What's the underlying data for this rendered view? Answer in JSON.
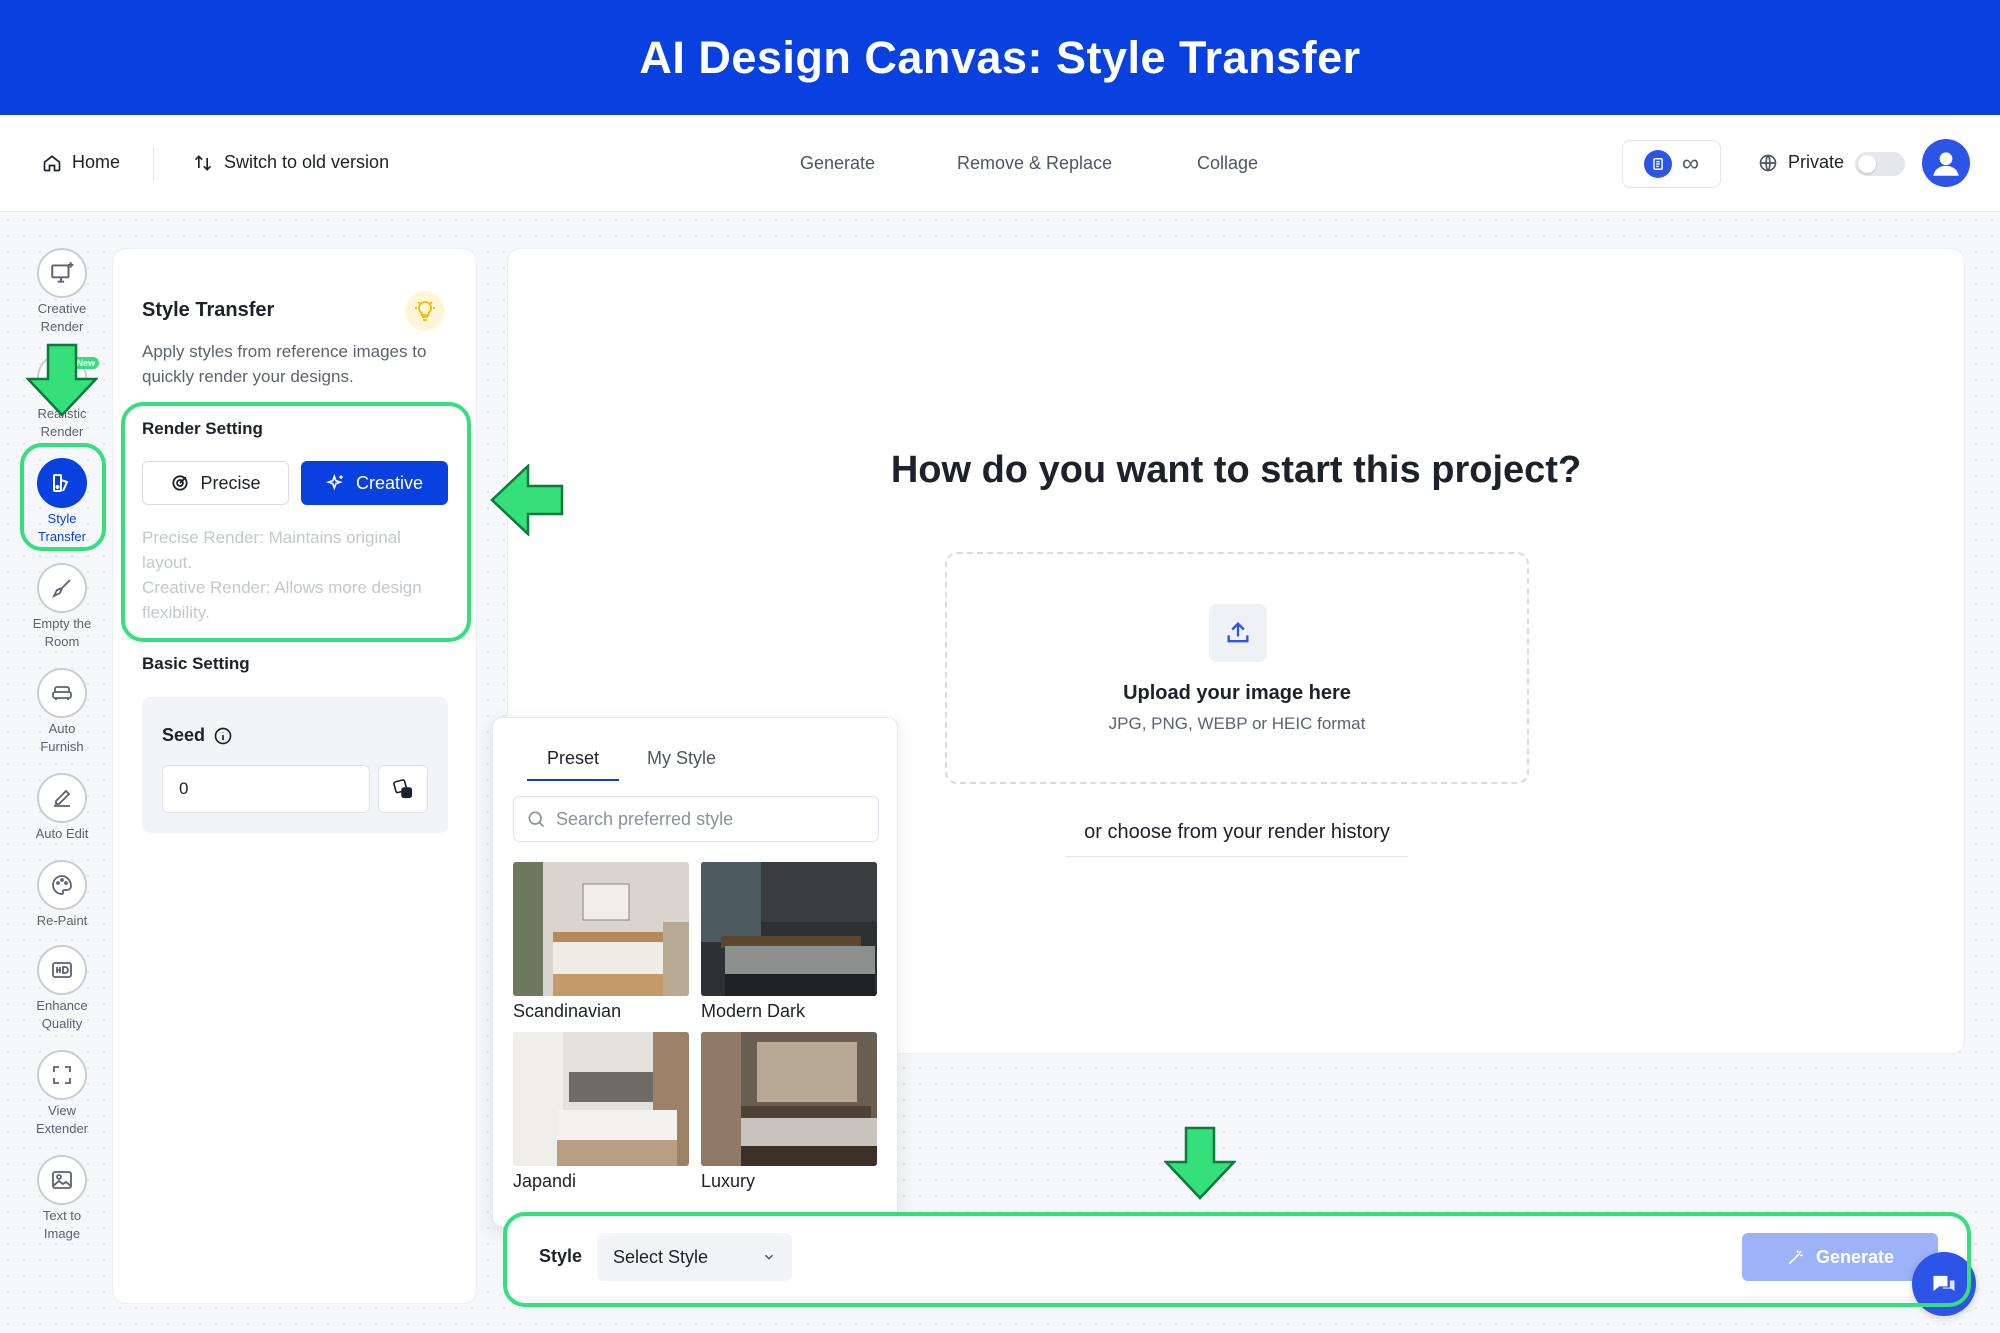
{
  "banner": {
    "title": "AI Design Canvas: Style Transfer"
  },
  "topbar": {
    "home": "Home",
    "switch_old": "Switch to old version",
    "nav": [
      "Generate",
      "Remove & Replace",
      "Collage"
    ],
    "credits_symbol": "∞",
    "privacy_label": "Private",
    "privacy_on": false
  },
  "tools": [
    {
      "line1": "Creative",
      "line2": "Render",
      "icon": "monitor-sparkle-icon"
    },
    {
      "line1": "Realistic",
      "line2": "Render",
      "icon": "camera-icon",
      "badge": "New"
    },
    {
      "line1": "Style",
      "line2": "Transfer",
      "icon": "palette-icon",
      "active": true
    },
    {
      "line1": "Empty the",
      "line2": "Room",
      "icon": "broom-icon"
    },
    {
      "line1": "Auto",
      "line2": "Furnish",
      "icon": "sofa-icon"
    },
    {
      "line1": "Auto Edit",
      "line2": "",
      "icon": "edit-icon"
    },
    {
      "line1": "Re-Paint",
      "line2": "",
      "icon": "paint-palette-icon"
    },
    {
      "line1": "Enhance",
      "line2": "Quality",
      "icon": "hd-icon"
    },
    {
      "line1": "View",
      "line2": "Extender",
      "icon": "expand-icon"
    },
    {
      "line1": "Text to",
      "line2": "Image",
      "icon": "image-icon"
    }
  ],
  "panel": {
    "title": "Style Transfer",
    "description": "Apply styles from reference images to quickly render your designs.",
    "render_heading": "Render Setting",
    "precise_label": "Precise",
    "creative_label": "Creative",
    "precise_note": "Precise Render: Maintains original layout.",
    "creative_note": "Creative Render: Allows more design flexibility.",
    "basic_heading": "Basic Setting",
    "seed_label": "Seed",
    "seed_value": "0"
  },
  "canvas": {
    "question": "How do you want to start this project?",
    "upload_title": "Upload your image here",
    "upload_formats": "JPG, PNG, WEBP or HEIC format",
    "history_link": "or choose from your render history"
  },
  "style_popup": {
    "tab_preset": "Preset",
    "tab_my_style": "My Style",
    "search_placeholder": "Search preferred style",
    "styles": [
      "Scandinavian",
      "Modern Dark",
      "Japandi",
      "Luxury"
    ]
  },
  "bottom": {
    "style_label": "Style",
    "select_placeholder": "Select Style",
    "generate_label": "Generate"
  },
  "colors": {
    "brand": "#0940e0",
    "highlight": "#35e07a"
  }
}
